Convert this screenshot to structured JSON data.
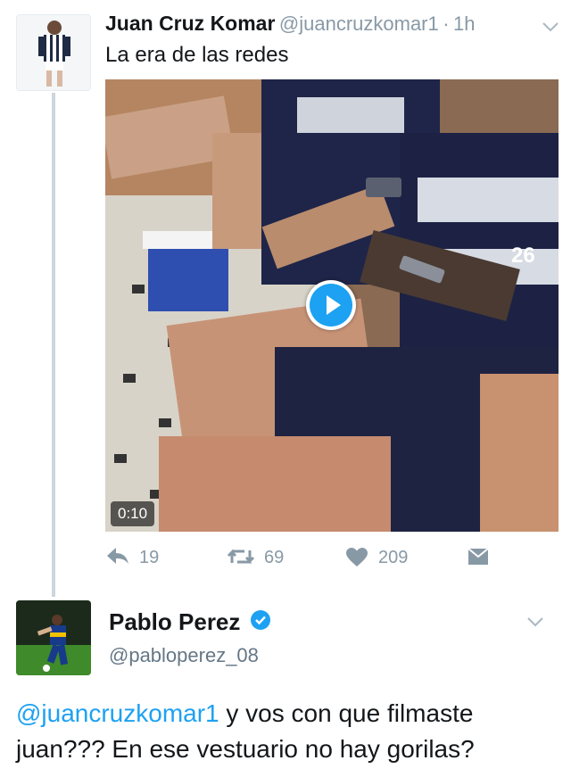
{
  "tweet": {
    "author_name": "Juan Cruz Komar",
    "author_handle": "@juancruzkomar1",
    "separator": "·",
    "time": "1h",
    "text": "La era de las redes",
    "video": {
      "duration": "0:10"
    },
    "actions": {
      "replies": "19",
      "retweets": "69",
      "likes": "209"
    }
  },
  "reply": {
    "author_name": "Pablo Perez",
    "author_handle": "@pabloperez_08",
    "verified": true,
    "mention": "@juancruzkomar1",
    "text": " y vos con que filmaste juan??? En ese vestuario no hay gorilas?"
  },
  "colors": {
    "accent": "#1da1f2",
    "muted": "#8899a6",
    "thread": "#ccd6dd"
  }
}
